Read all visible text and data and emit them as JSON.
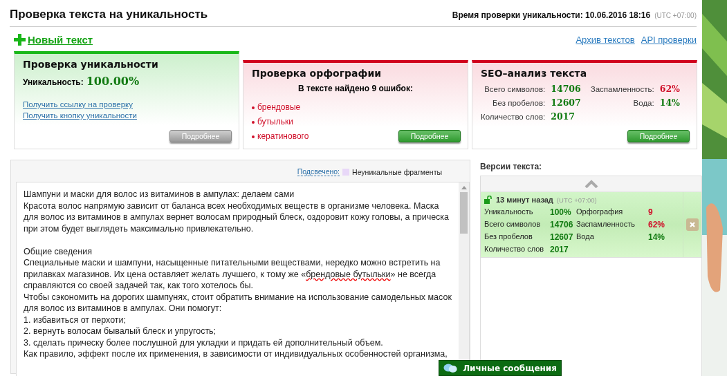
{
  "header": {
    "title": "Проверка текста на уникальность",
    "time_label": "Время проверки уникальности: 10.06.2016 18:16",
    "timezone": "(UTC +07:00)"
  },
  "new_text_link": "Новый текст",
  "top_links": [
    "Архив текстов",
    "API проверки"
  ],
  "tabs": [
    {
      "kind": "uniqueness",
      "selected": true,
      "title": "Проверка уникальности",
      "uniqueness_label": "Уникальность:",
      "uniqueness_value": "100.00%",
      "links": [
        "Получить ссылку на проверку",
        "Получить кнопку уникальности"
      ],
      "button": "Подробнее"
    },
    {
      "kind": "spelling",
      "selected": false,
      "title": "Проверка орфографии",
      "summary": "В тексте найдено 9 ошибок:",
      "errors": [
        "брендовые",
        "бутыльки",
        "кератинового"
      ],
      "button": "Подробнее"
    },
    {
      "kind": "seo",
      "selected": false,
      "title": "SEO–анализ текста",
      "stats": [
        {
          "label": "Всего символов:",
          "value": "14706",
          "color": "#117a11"
        },
        {
          "label": "Заспамленность:",
          "value": "62%",
          "color": "#d0102a"
        },
        {
          "label": "Без пробелов:",
          "value": "12607",
          "color": "#117a11"
        },
        {
          "label": "Вода:",
          "value": "14%",
          "color": "#117a11"
        },
        {
          "label": "Количество слов:",
          "value": "2017",
          "color": "#117a11"
        }
      ],
      "button": "Подробнее"
    }
  ],
  "legend": {
    "link": "Подсвечено:",
    "label": "Неуникальные фрагменты"
  },
  "text_lines": [
    {
      "gap_before": false,
      "segments": [
        {
          "text": "Шампуни и маски для волос из витаминов в ампулах: делаем сами",
          "error": false
        }
      ]
    },
    {
      "gap_before": false,
      "segments": [
        {
          "text": "Красота волос напрямую зависит от баланса всех необходимых веществ в организме человека. Маска для волос из витаминов в ампулах вернет волосам природный блеск, оздоровит кожу головы, а прическа при этом будет выглядеть максимально привлекательно.",
          "error": false
        }
      ]
    },
    {
      "gap_before": true,
      "segments": [
        {
          "text": "Общие сведения",
          "error": false
        }
      ]
    },
    {
      "gap_before": false,
      "segments": [
        {
          "text": "Специальные маски и шампуни, насыщенные питательными веществами, нередко можно встретить на прилавках магазинов. Их цена оставляет желать лучшего, к тому же «",
          "error": false
        },
        {
          "text": "брендовые бутыльки",
          "error": true
        },
        {
          "text": "» не всегда справляются со своей задачей так, как того хотелось бы.",
          "error": false
        }
      ]
    },
    {
      "gap_before": false,
      "segments": [
        {
          "text": "Чтобы сэкономить на дорогих шампунях, стоит обратить внимание на использование самодельных масок для волос из витаминов в ампулах. Они помогут:",
          "error": false
        }
      ]
    },
    {
      "gap_before": false,
      "segments": [
        {
          "text": "1. избавиться от перхоти;",
          "error": false
        }
      ]
    },
    {
      "gap_before": false,
      "segments": [
        {
          "text": "2. вернуть волосам бывалый блеск и упругость;",
          "error": false
        }
      ]
    },
    {
      "gap_before": false,
      "segments": [
        {
          "text": "3. сделать прическу более послушной для укладки и придать ей дополнительный объем.",
          "error": false
        }
      ]
    },
    {
      "gap_before": false,
      "segments": [
        {
          "text": "Как правило, эффект после их применения, в зависимости от индивидуальных особенностей организма,",
          "error": false
        }
      ]
    }
  ],
  "versions": {
    "title": "Версии текста:",
    "items": [
      {
        "locked": false,
        "time": "13 минут назад",
        "timezone": "(UTC +07:00)",
        "stats": [
          {
            "label": "Уникальность",
            "value": "100%",
            "color": "#117a11"
          },
          {
            "label": "Орфография",
            "value": "9",
            "color": "#d0102a"
          },
          {
            "label": "Всего символов",
            "value": "14706",
            "color": "#117a11"
          },
          {
            "label": "Заспамленность",
            "value": "62%",
            "color": "#d0102a"
          },
          {
            "label": "Без пробелов",
            "value": "12607",
            "color": "#117a11"
          },
          {
            "label": "Вода",
            "value": "14%",
            "color": "#117a11"
          },
          {
            "label": "Количество слов",
            "value": "2017",
            "color": "#117a11"
          }
        ]
      }
    ]
  },
  "messages_button": "Личные сообщения"
}
